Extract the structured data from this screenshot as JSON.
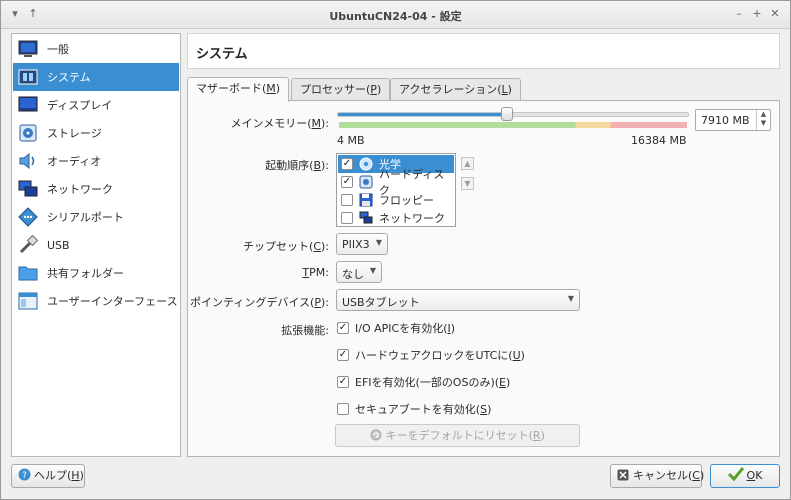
{
  "window": {
    "title": "UbuntuCN24-04 - 設定",
    "menu_glyph": "▾",
    "up_glyph": "↑",
    "min_glyph": "–",
    "max_glyph": "+",
    "close_glyph": "✕"
  },
  "sidebar": {
    "items": [
      {
        "label": "一般",
        "icon": "monitor-icon"
      },
      {
        "label": "システム",
        "icon": "chip-icon",
        "selected": true
      },
      {
        "label": "ディスプレイ",
        "icon": "display-icon"
      },
      {
        "label": "ストレージ",
        "icon": "storage-icon"
      },
      {
        "label": "オーディオ",
        "icon": "speaker-icon"
      },
      {
        "label": "ネットワーク",
        "icon": "network-icon"
      },
      {
        "label": "シリアルポート",
        "icon": "serial-port-icon"
      },
      {
        "label": "USB",
        "icon": "usb-icon"
      },
      {
        "label": "共有フォルダー",
        "icon": "folder-icon"
      },
      {
        "label": "ユーザーインターフェース",
        "icon": "ui-window-icon"
      }
    ]
  },
  "page": {
    "title": "システム"
  },
  "tabs": [
    {
      "label": "マザーボード(",
      "key": "M",
      "suffix": ")",
      "active": true
    },
    {
      "label": "プロセッサー(",
      "key": "P",
      "suffix": ")"
    },
    {
      "label": "アクセラレーション(",
      "key": "L",
      "suffix": ")"
    }
  ],
  "motherboard": {
    "memory": {
      "label": "メインメモリー(",
      "key": "M",
      "suffix": "):",
      "min_label": "4 MB",
      "max_label": "16384 MB",
      "min": 4,
      "max": 16384,
      "value": 7910,
      "value_text": "7910 MB",
      "spin_up": "▲",
      "spin_down": "▼"
    },
    "boot_order": {
      "label": "起動順序(",
      "key": "B",
      "suffix": "):",
      "check_glyph": "✓",
      "up_glyph": "▲",
      "down_glyph": "▼",
      "items": [
        {
          "label": "光学",
          "checked": true,
          "icon": "optical-disc-icon",
          "selected": true
        },
        {
          "label": "ハードディスク",
          "checked": true,
          "icon": "hard-disk-icon"
        },
        {
          "label": "フロッピー",
          "checked": false,
          "icon": "floppy-icon"
        },
        {
          "label": "ネットワーク",
          "checked": false,
          "icon": "network-boot-icon"
        }
      ]
    },
    "chipset": {
      "label": "チップセット(",
      "key": "C",
      "suffix": "):",
      "value": "PIIX3"
    },
    "tpm": {
      "key": "T",
      "label": "PM:",
      "value": "なし"
    },
    "pointing": {
      "label": "ポインティングデバイス(",
      "key": "P",
      "suffix": "):",
      "value": "USBタブレット"
    },
    "combo_arrow": "▼",
    "extended": {
      "label": "拡張機能:",
      "options": [
        {
          "label": "I/O APICを有効化(",
          "key": "I",
          "suffix": ")",
          "checked": true
        },
        {
          "label": "ハードウェアクロックをUTCに(",
          "key": "U",
          "suffix": ")",
          "checked": true
        },
        {
          "label": "EFIを有効化(一部のOSのみ)(",
          "key": "E",
          "suffix": ")",
          "checked": true
        },
        {
          "label": "セキュアブートを有効化(",
          "key": "S",
          "suffix": ")",
          "checked": false
        }
      ]
    },
    "reset_button": {
      "label": "キーをデフォルトにリセット(",
      "key": "R",
      "suffix": ")"
    }
  },
  "footer": {
    "help": {
      "label": "ヘルプ(",
      "key": "H",
      "suffix": ")"
    },
    "cancel": {
      "label": "キャンセル(",
      "key": "C",
      "suffix": ")"
    },
    "ok": {
      "label": "",
      "key": "O",
      "suffix": "K"
    }
  },
  "colors": {
    "accent": "#3a8fd2",
    "ok_check": "#5aa02c"
  }
}
